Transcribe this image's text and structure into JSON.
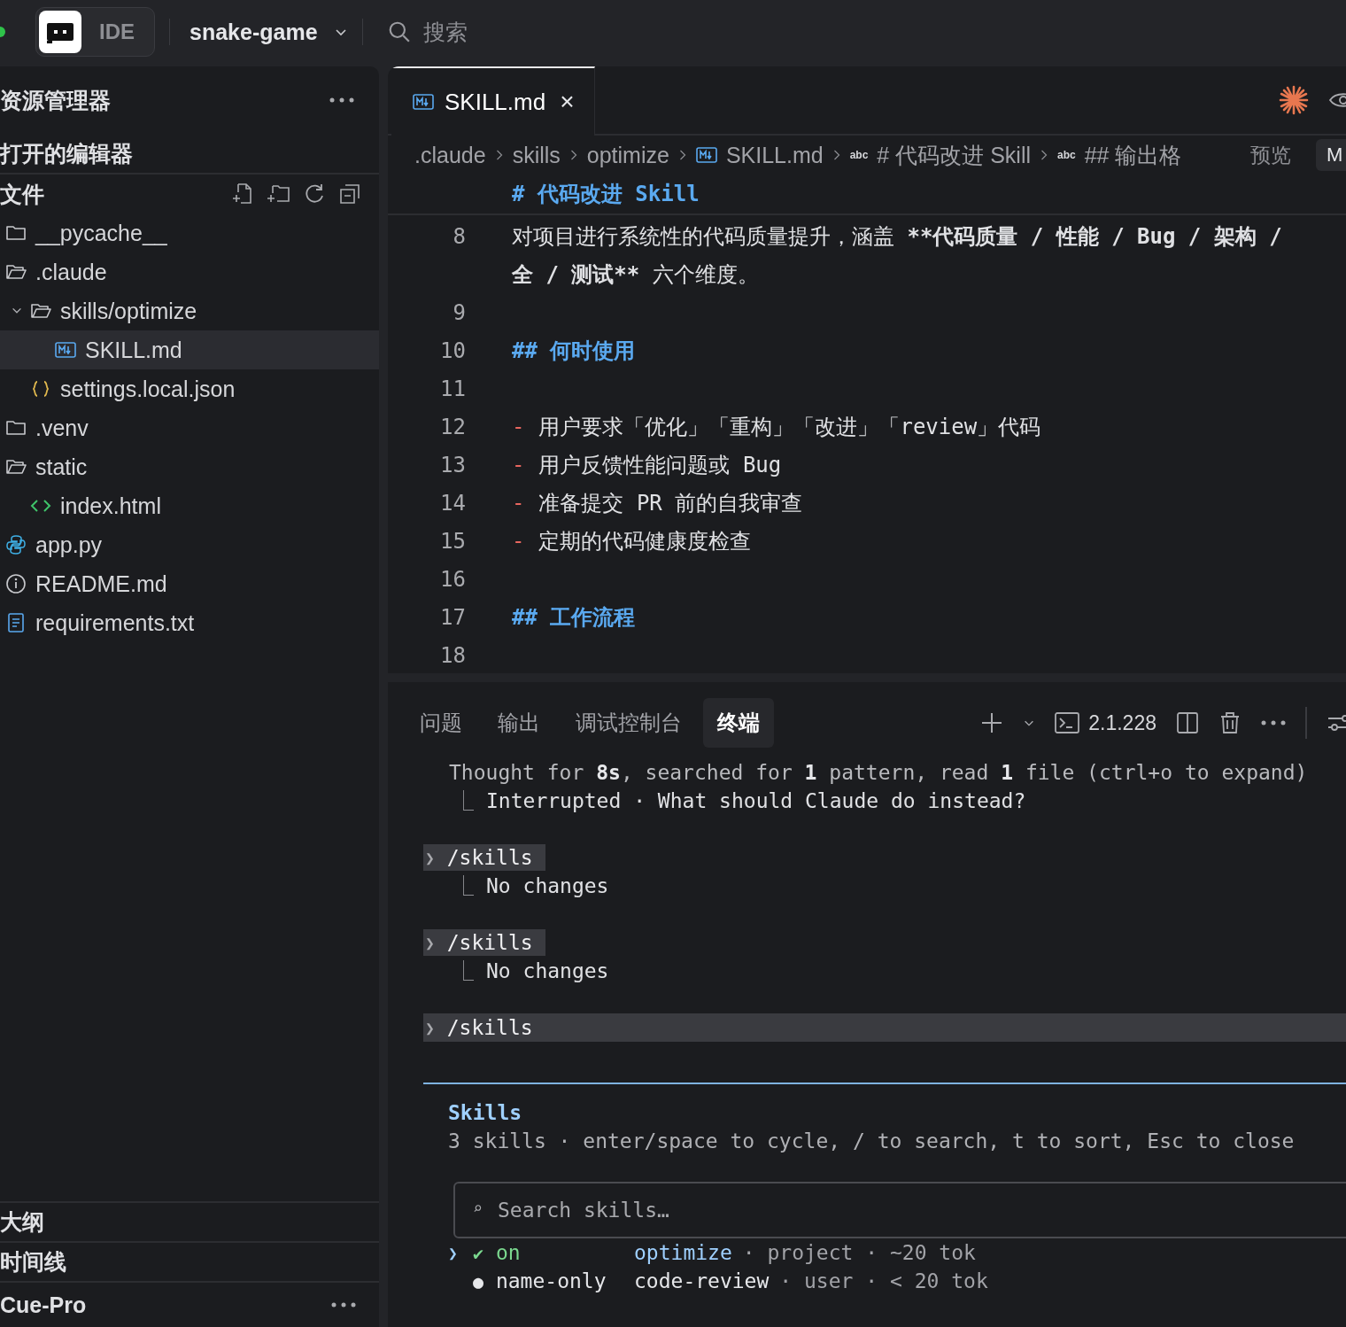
{
  "topbar": {
    "mode_label": "IDE",
    "project": "snake-game",
    "search_placeholder": "搜索"
  },
  "sidebar": {
    "title": "资源管理器",
    "open_editors": "打开的编辑器",
    "files_section": "文件",
    "tree": [
      {
        "label": "__pycache__",
        "kind": "folder",
        "expanded": false,
        "selected": false
      },
      {
        "label": ".claude",
        "kind": "folder",
        "expanded": true,
        "selected": false,
        "children": [
          {
            "label": "skills/optimize",
            "kind": "folder",
            "expanded": true,
            "selected": false,
            "children": [
              {
                "label": "SKILL.md",
                "kind": "markdown",
                "selected": true
              }
            ]
          },
          {
            "label": "settings.local.json",
            "kind": "json",
            "selected": false
          }
        ]
      },
      {
        "label": ".venv",
        "kind": "folder",
        "expanded": false,
        "selected": false
      },
      {
        "label": "static",
        "kind": "folder",
        "expanded": true,
        "selected": false,
        "children": [
          {
            "label": "index.html",
            "kind": "html",
            "selected": false
          }
        ]
      },
      {
        "label": "app.py",
        "kind": "python",
        "selected": false
      },
      {
        "label": "README.md",
        "kind": "info",
        "selected": false
      },
      {
        "label": "requirements.txt",
        "kind": "text",
        "selected": false
      }
    ],
    "sections": [
      "大纲",
      "时间线"
    ],
    "footer": "Cue-Pro"
  },
  "editor": {
    "tabs": [
      {
        "label": "SKILL.md",
        "close": "×",
        "selected": true
      }
    ],
    "breadcrumbs": [
      {
        "label": ".claude",
        "kind": "plain"
      },
      {
        "label": "skills",
        "kind": "plain"
      },
      {
        "label": "optimize",
        "kind": "plain"
      },
      {
        "label": "SKILL.md",
        "kind": "markdown"
      },
      {
        "label": "# 代码改进 Skill",
        "kind": "symbol",
        "icon_text": "abc"
      },
      {
        "label": "## 输出格",
        "kind": "symbol",
        "icon_text": "abc"
      }
    ],
    "preview_button": "预览",
    "mode_button": "M",
    "sticky_heading": "# 代码改进 Skill",
    "lines": [
      {
        "number": "8",
        "kind": "text",
        "segments": [
          {
            "text": "对项目进行系统性的代码质量提升，涵盖 ",
            "bold": false
          },
          {
            "text": "**代码质量 / 性能 / Bug / 架构 /",
            "bold": true
          }
        ],
        "wrap": [
          {
            "text": "全 / 测试**",
            "bold": true
          },
          {
            "text": " 六个维度。",
            "bold": false
          }
        ]
      },
      {
        "number": "9",
        "kind": "blank"
      },
      {
        "number": "10",
        "kind": "heading",
        "text": "## 何时使用"
      },
      {
        "number": "11",
        "kind": "blank"
      },
      {
        "number": "12",
        "kind": "bullet",
        "marker": "-",
        "text": "用户要求「优化」「重构」「改进」「review」代码"
      },
      {
        "number": "13",
        "kind": "bullet",
        "marker": "-",
        "text": "用户反馈性能问题或 Bug"
      },
      {
        "number": "14",
        "kind": "bullet",
        "marker": "-",
        "text": "准备提交 PR 前的自我审查"
      },
      {
        "number": "15",
        "kind": "bullet",
        "marker": "-",
        "text": "定期的代码健康度检查"
      },
      {
        "number": "16",
        "kind": "blank"
      },
      {
        "number": "17",
        "kind": "heading",
        "text": "## 工作流程"
      },
      {
        "number": "18",
        "kind": "blank"
      }
    ]
  },
  "panel": {
    "tabs": [
      {
        "label": "问题",
        "selected": false
      },
      {
        "label": "输出",
        "selected": false
      },
      {
        "label": "调试控制台",
        "selected": false
      },
      {
        "label": "终端",
        "selected": true
      }
    ],
    "version": "2.1.228",
    "terminal": [
      {
        "kind": "status",
        "text": "Thought for **8s**, searched for **1** pattern, read **1** file (ctrl+o to expand)"
      },
      {
        "kind": "result",
        "mark": "⎿",
        "text": "Interrupted · What should Claude do instead?"
      },
      {
        "kind": "command",
        "prompt": "❯",
        "text": "/skills",
        "current": false
      },
      {
        "kind": "result",
        "mark": "⎿",
        "text": "No changes"
      },
      {
        "kind": "command",
        "prompt": "❯",
        "text": "/skills",
        "current": false
      },
      {
        "kind": "result",
        "mark": "⎿",
        "text": "No changes"
      },
      {
        "kind": "command",
        "prompt": "❯",
        "text": "/skills",
        "current": true
      }
    ],
    "dialog": {
      "title": "Skills",
      "description": "3 skills · enter/space to cycle, / to search, t to sort, Esc to close",
      "search_icon": "⌕",
      "search_placeholder": "Search skills…",
      "pointer": "❯",
      "items": [
        {
          "selected": true,
          "enabled": true,
          "state_mark": "✔",
          "state": "on",
          "name": "optimize",
          "meta": "· project · ~20 tok"
        },
        {
          "selected": false,
          "enabled": false,
          "state_mark": "●",
          "state": "name-only",
          "name": "code-review",
          "meta": "· user · < 20 tok"
        }
      ]
    }
  }
}
